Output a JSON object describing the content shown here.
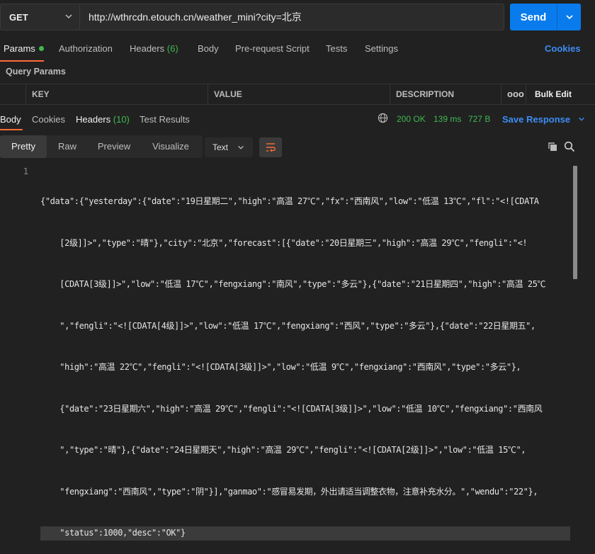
{
  "request": {
    "method": "GET",
    "url": "http://wthrcdn.etouch.cn/weather_mini?city=北京",
    "send_label": "Send"
  },
  "request_tabs": {
    "params": "Params",
    "authorization": "Authorization",
    "headers": "Headers",
    "headers_count": "(6)",
    "body": "Body",
    "prerequest": "Pre-request Script",
    "tests": "Tests",
    "settings": "Settings",
    "cookies": "Cookies"
  },
  "query_params": {
    "title": "Query Params",
    "columns": {
      "key": "KEY",
      "value": "VALUE",
      "description": "DESCRIPTION"
    },
    "more": "ooo",
    "bulk_edit": "Bulk Edit"
  },
  "response_tabs": {
    "body": "Body",
    "cookies": "Cookies",
    "headers": "Headers",
    "headers_count": "(10)",
    "test_results": "Test Results"
  },
  "response_status": {
    "status": "200 OK",
    "time": "139 ms",
    "size": "727 B",
    "save_response": "Save Response"
  },
  "view_modes": [
    "Pretty",
    "Raw",
    "Preview",
    "Visualize"
  ],
  "format": "Text",
  "code": {
    "line_number": "1",
    "lines": [
      "{\"data\":{\"yesterday\":{\"date\":\"19日星期二\",\"high\":\"高温 27℃\",\"fx\":\"西南风\",\"low\":\"低温 13℃\",\"fl\":\"<![CDATA",
      "    [2级]]>\",\"type\":\"晴\"},\"city\":\"北京\",\"forecast\":[{\"date\":\"20日星期三\",\"high\":\"高温 29℃\",\"fengli\":\"<!",
      "    [CDATA[3级]]>\",\"low\":\"低温 17℃\",\"fengxiang\":\"南风\",\"type\":\"多云\"},{\"date\":\"21日星期四\",\"high\":\"高温 25℃",
      "    \",\"fengli\":\"<![CDATA[4级]]>\",\"low\":\"低温 17℃\",\"fengxiang\":\"西风\",\"type\":\"多云\"},{\"date\":\"22日星期五\",",
      "    \"high\":\"高温 22℃\",\"fengli\":\"<![CDATA[3级]]>\",\"low\":\"低温 9℃\",\"fengxiang\":\"西南风\",\"type\":\"多云\"},",
      "    {\"date\":\"23日星期六\",\"high\":\"高温 29℃\",\"fengli\":\"<![CDATA[3级]]>\",\"low\":\"低温 10℃\",\"fengxiang\":\"西南风",
      "    \",\"type\":\"晴\"},{\"date\":\"24日星期天\",\"high\":\"高温 29℃\",\"fengli\":\"<![CDATA[2级]]>\",\"low\":\"低温 15℃\",",
      "    \"fengxiang\":\"西南风\",\"type\":\"阴\"}],\"ganmao\":\"感冒易发期，外出请适当调整衣物，注意补充水分。\",\"wendu\":\"22\"},",
      "    \"status\":1000,\"desc\":\"OK\"}"
    ]
  },
  "colors": {
    "accent": "#ff6c37",
    "send": "#097bed",
    "status_green": "#3fb950",
    "link_blue": "#3d8df5"
  }
}
